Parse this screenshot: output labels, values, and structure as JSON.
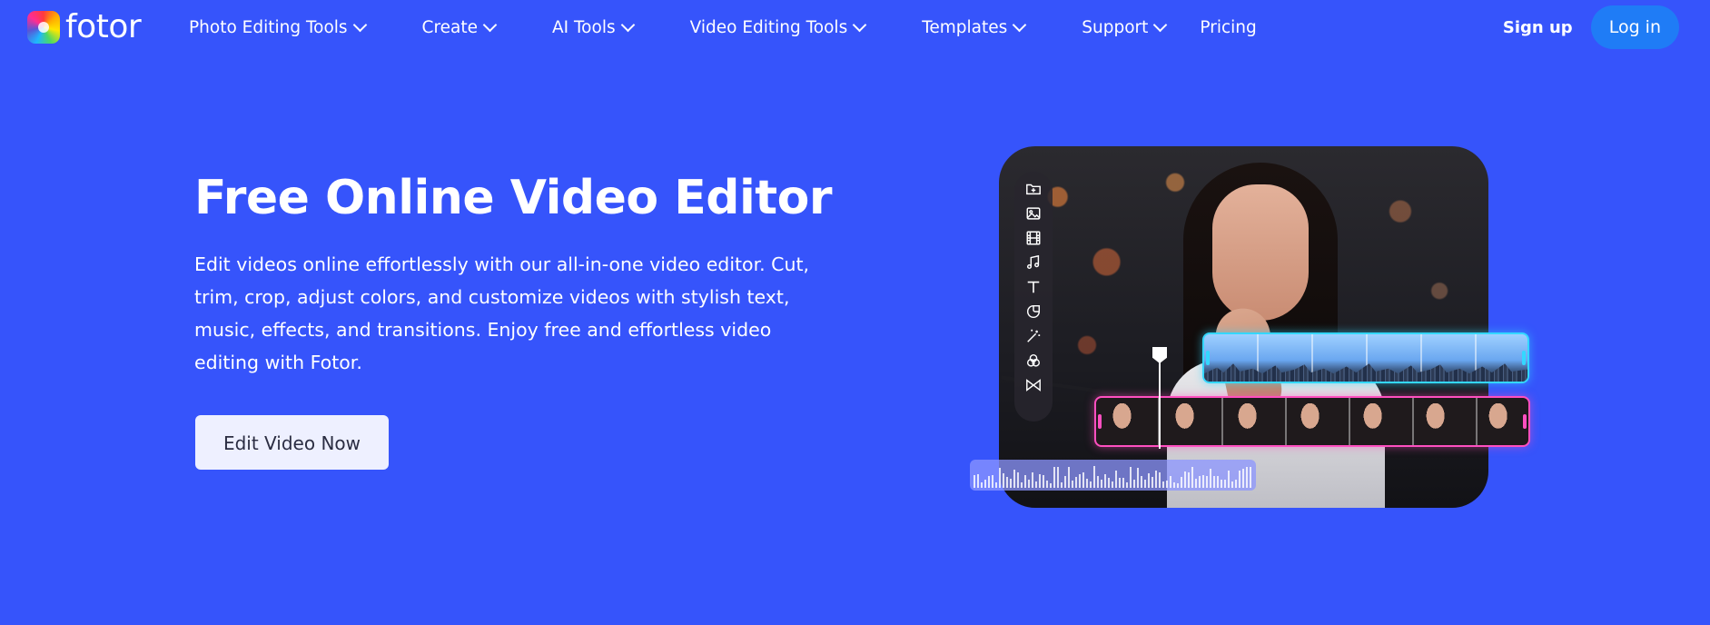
{
  "header": {
    "logo_text": "fotor",
    "nav": [
      {
        "label": "Photo Editing Tools"
      },
      {
        "label": "Create"
      },
      {
        "label": "AI Tools"
      },
      {
        "label": "Video Editing Tools"
      },
      {
        "label": "Templates"
      },
      {
        "label": "Support"
      },
      {
        "label": "Pricing"
      }
    ],
    "sign_up": "Sign up",
    "log_in": "Log in"
  },
  "hero": {
    "title": "Free Online Video Editor",
    "description": "Edit videos online effortlessly with our all-in-one video editor. Cut, trim, crop, adjust colors, and customize videos with stylish text, music, effects, and transitions. Enjoy free and effortless video editing with Fotor.",
    "cta_label": "Edit Video Now"
  },
  "editor_preview": {
    "tools": [
      "folder-plus-icon",
      "image-icon",
      "film-icon",
      "music-icon",
      "text-icon",
      "sticker-icon",
      "magic-wand-icon",
      "filter-icon",
      "transition-icon"
    ]
  },
  "colors": {
    "background": "#3654fb",
    "login_button": "#1f7cf6",
    "cta_background": "#eef0ff",
    "clip_cyan": "#34d7ff",
    "clip_pink": "#ff4fc0"
  }
}
